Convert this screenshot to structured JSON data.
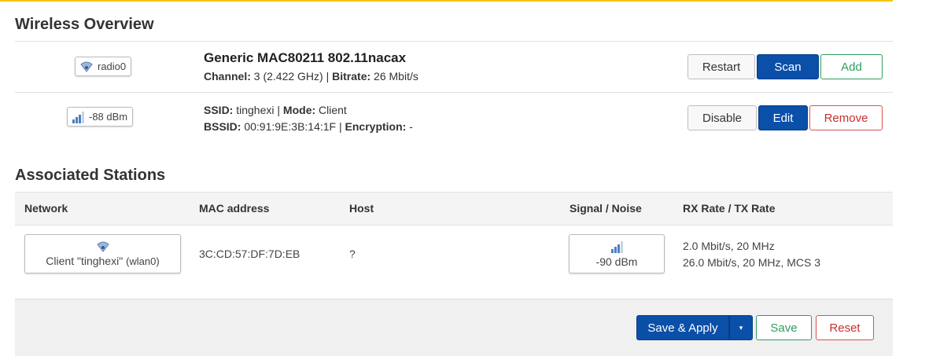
{
  "overview": {
    "heading": "Wireless Overview",
    "radio": {
      "badge": "radio0",
      "icon": "wifi-icon",
      "title": "Generic MAC80211 802.11nacax",
      "channel_label": "Channel:",
      "channel_value": "3 (2.422 GHz)",
      "bitrate_label": "Bitrate:",
      "bitrate_value": "26 Mbit/s",
      "buttons": {
        "restart": "Restart",
        "scan": "Scan",
        "add": "Add"
      }
    },
    "network": {
      "signal_badge": "-88 dBm",
      "ssid_label": "SSID:",
      "ssid_value": "tinghexi",
      "mode_label": "Mode:",
      "mode_value": "Client",
      "bssid_label": "BSSID:",
      "bssid_value": "00:91:9E:3B:14:1F",
      "encryption_label": "Encryption:",
      "encryption_value": "-",
      "buttons": {
        "disable": "Disable",
        "edit": "Edit",
        "remove": "Remove"
      }
    }
  },
  "stations": {
    "heading": "Associated Stations",
    "columns": [
      "Network",
      "MAC address",
      "Host",
      "Signal / Noise",
      "RX Rate / TX Rate"
    ],
    "rows": [
      {
        "network_name": "Client \"tinghexi\"",
        "network_iface": "(wlan0)",
        "mac": "3C:CD:57:DF:7D:EB",
        "host": "?",
        "signal": "-90 dBm",
        "rx_rate": "2.0 Mbit/s, 20 MHz",
        "tx_rate": "26.0 Mbit/s, 20 MHz, MCS 3"
      }
    ]
  },
  "footer": {
    "save_apply": "Save & Apply",
    "dropdown_arrow": "▾",
    "save": "Save",
    "reset": "Reset"
  },
  "colors": {
    "primary": "#0a4fa8",
    "positive": "#2f9e5e",
    "negative": "#c9302c",
    "accent_bar": "#f5c518"
  }
}
